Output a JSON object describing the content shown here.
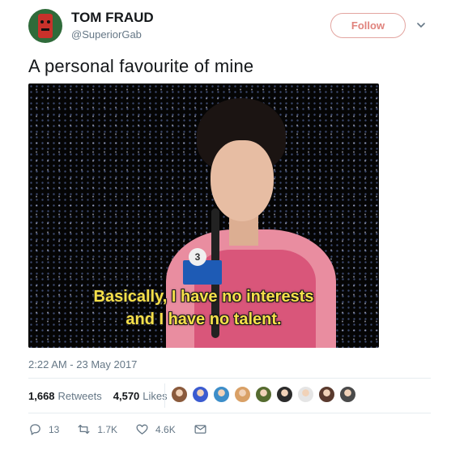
{
  "user": {
    "name": "TOM FRAUD",
    "handle": "@SuperiorGab"
  },
  "follow_button": {
    "label": "Follow"
  },
  "tweet": {
    "text": "A personal favourite of mine",
    "media": {
      "badge_number": "3",
      "subtitle_line1": "Basically, I have no interests",
      "subtitle_line2": "and I have no talent."
    },
    "timestamp": "2:22 AM - 23 May 2017"
  },
  "stats": {
    "retweets_count": "1,668",
    "retweets_label": "Retweets",
    "likes_count": "4,570",
    "likes_label": "Likes",
    "liker_avatar_colors": [
      "#8a5a3c",
      "#3b5bd0",
      "#3d8ec9",
      "#d9a066",
      "#556b2f",
      "#2b2b2b",
      "#e5e5e5",
      "#5a3a2e",
      "#4a4a4a"
    ]
  },
  "actions": {
    "reply_count": "13",
    "retweet_count": "1.7K",
    "like_count": "4.6K"
  },
  "colors": {
    "follow_accent": "#e0837d",
    "muted_text": "#657786"
  }
}
